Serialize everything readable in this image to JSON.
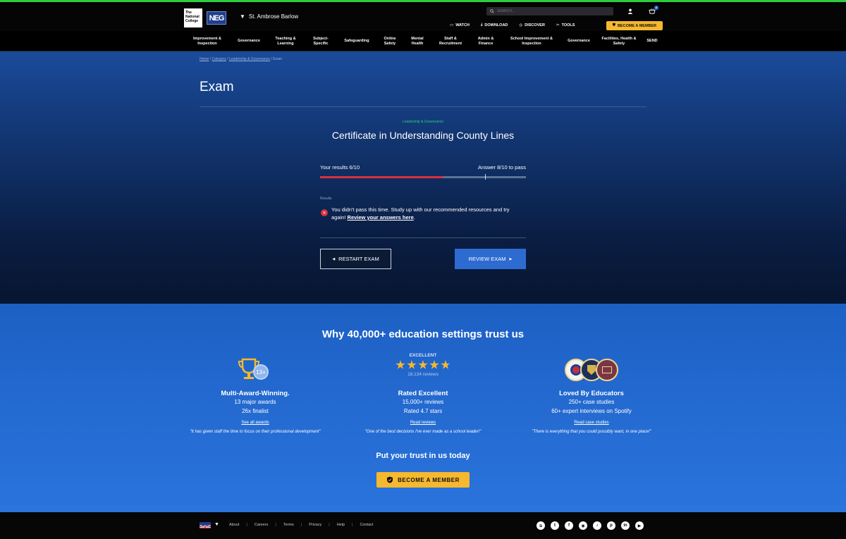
{
  "header": {
    "logo_text": "The National College",
    "neg_logo": "NEG",
    "school_name": "St. Ambrose Barlow",
    "search_placeholder": "SEARCH...",
    "cart_count": "0",
    "links": [
      "WATCH",
      "DOWNLOAD",
      "DISCOVER",
      "TOOLS"
    ],
    "become_member": "BECOME A MEMBER"
  },
  "category_nav": [
    "Improvement & Inspection",
    "Governance",
    "Teaching & Learning",
    "Subject-Specific",
    "Safeguarding",
    "Online Safety",
    "Mental Health",
    "Staff & Recruitment",
    "Admin & Finance",
    "School Improvement & Inspection",
    "Governance",
    "Facilities, Health & Safety",
    "SEND"
  ],
  "breadcrumb": [
    "Home",
    "Category",
    "Leadership & Governance",
    "Exam"
  ],
  "page_title": "Exam",
  "exam": {
    "category": "Leadership & Governance",
    "title": "Certificate in Understanding County Lines",
    "results_text": "Your results 6/10",
    "pass_text": "Answer 8/10 to pass",
    "score_fraction": 0.6,
    "pass_fraction": 0.8,
    "results_label": "Results",
    "fail_message": "You didn't pass this time. Study up with our recommended resources and try again!",
    "review_link": "Review your answers here",
    "restart_label": "RESTART EXAM",
    "review_label": "REVIEW EXAM"
  },
  "trust": {
    "title": "Why 40,000+ education settings trust us",
    "columns": [
      {
        "badge": "13+",
        "heading": "Multi-Award-Winning.",
        "line1": "13 major awards",
        "line2": "26x finalist",
        "link": "See all awards",
        "quote": "\"It has given staff the time to focus on their professional development\""
      },
      {
        "rating_word": "EXCELLENT",
        "rating_stars": 4.7,
        "reviews": "18,134 reviews",
        "heading": "Rated Excellent",
        "line1": "15,000+ reviews",
        "line2": "Rated 4.7 stars",
        "link": "Read reviews",
        "quote": "\"One of the best decisions I've ever made as a school leader!\""
      },
      {
        "heading": "Loved By Educators",
        "line1": "250+ case studies",
        "line2": "60+ expert interviews on Spotify",
        "link": "Read case studies",
        "quote": "\"There is everything that you could possibly want, in one place!\""
      }
    ],
    "cta_title": "Put your trust in us today",
    "cta_button": "BECOME A MEMBER"
  },
  "footer": {
    "links": [
      "About",
      "Careers",
      "Terms",
      "Privacy",
      "Help",
      "Contact"
    ],
    "socials": [
      "spotify-icon",
      "twitter-icon",
      "facebook-icon",
      "instagram-icon",
      "tiktok-icon",
      "pinterest-icon",
      "linkedin-icon",
      "youtube-icon"
    ]
  },
  "colors": {
    "accent_yellow": "#f5b82e",
    "fail_red": "#d8323e",
    "category_green": "#29d17a",
    "primary_blue": "#2d6bd1"
  }
}
